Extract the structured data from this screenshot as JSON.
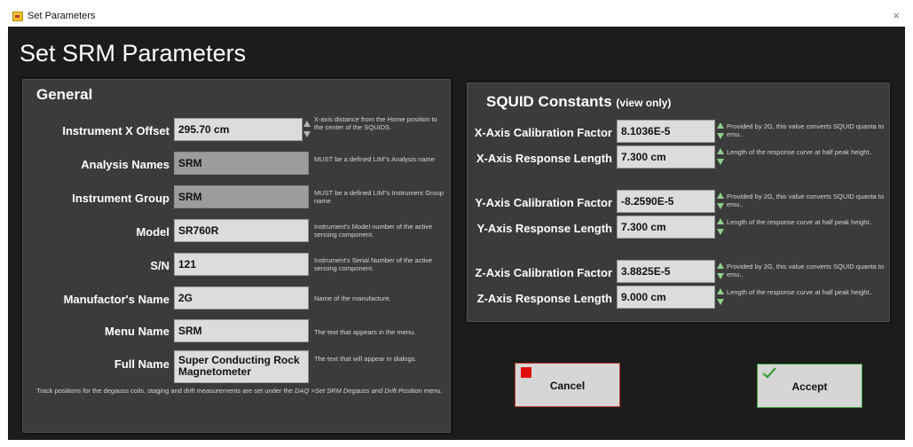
{
  "window": {
    "title": "Set Parameters",
    "close_glyph": "×",
    "app_icon": "app-icon"
  },
  "page_title": "Set SRM Parameters",
  "general": {
    "title": "General",
    "rows": [
      {
        "label": "Instrument X Offset",
        "value": "295.70 cm",
        "desc": "X-axis distance from the Home position to the center of the SQUIDS.",
        "spinner": true,
        "readonly": false
      },
      {
        "label": "Analysis Names",
        "value": "SRM",
        "desc": "MUST be a defined LIM\"s Analysis name",
        "readonly": true
      },
      {
        "label": "Instrument Group",
        "value": "SRM",
        "desc": "MUST be a defined LIM\"s Instrument Group name",
        "readonly": true
      },
      {
        "label": "Model",
        "value": "SR760R",
        "desc": "Instrument's Model number of the active sensing component.",
        "readonly": false
      },
      {
        "label": "S/N",
        "value": "121",
        "desc": "Instrument's Serial Number of the active sensing component.",
        "readonly": false
      },
      {
        "label": "Manufactor's Name",
        "value": "2G",
        "desc": "Name of the manufacture.",
        "readonly": false
      },
      {
        "label": "Menu Name",
        "value": "SRM",
        "desc": "The text that appears in the menu.",
        "readonly": false
      },
      {
        "label": "Full Name",
        "value": "Super Conducting Rock Magnetometer",
        "desc": "The text that will appear in dialogs.",
        "readonly": false
      }
    ],
    "note_prefix": "Track positions for the degauss coils, staging and drift measurements are set under the ",
    "note_menu": "DAQ >Set SRM Degauss and Drift Position",
    "note_suffix": " menu."
  },
  "squid": {
    "title": "SQUID Constants",
    "view_only": "(view only)",
    "rows": [
      {
        "label": "X-Axis Calibration Factor",
        "value": "8.1036E-5",
        "desc": "Provided by 2G, this value converts SQUID quanta to emu.."
      },
      {
        "label": "X-Axis Response Length",
        "value": "7.300 cm",
        "desc": "Length of the response curve at half peak height.."
      },
      {
        "label": "Y-Axis Calibration Factor",
        "value": "-8.2590E-5",
        "desc": "Provided by 2G, this value converts SQUID quanta to emu.."
      },
      {
        "label": "Y-Axis Response Length",
        "value": "7.300 cm",
        "desc": "Length of the response curve at half peak height.."
      },
      {
        "label": "Z-Axis Calibration Factor",
        "value": "3.8825E-5",
        "desc": "Provided by 2G, this value converts SQUID quanta to emu.."
      },
      {
        "label": "Z-Axis Response Length",
        "value": "9.000 cm",
        "desc": "Length of the response curve at half peak height.."
      }
    ]
  },
  "buttons": {
    "cancel": {
      "label": "Cancel",
      "icon": "stop-icon",
      "accent": "#e01010"
    },
    "accept": {
      "label": "Accept",
      "icon": "check-icon",
      "accent": "#3a9b3a"
    }
  },
  "colors": {
    "background": "#1c1c1c",
    "panel": "#3b3b3b",
    "field": "#dcdcdc",
    "field_readonly": "#9c9c9c"
  }
}
